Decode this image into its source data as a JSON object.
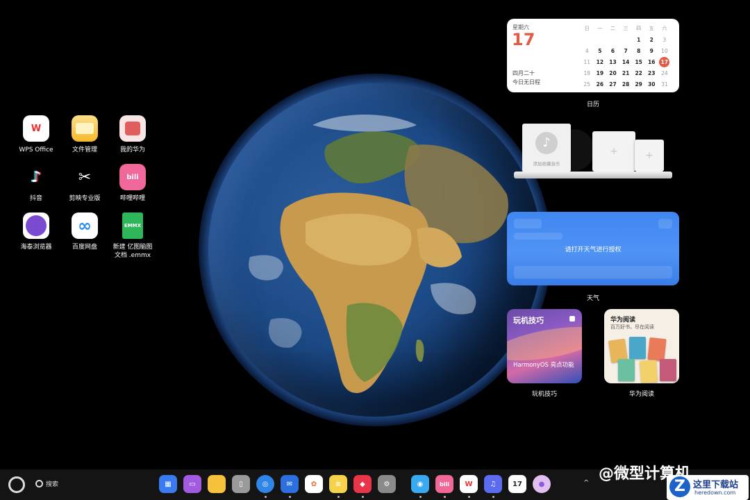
{
  "desktop_icons": [
    {
      "label": "WPS Office",
      "icon": "wps-icon",
      "glyph": "W",
      "bg": "#ffffff",
      "fg": "#e8312f"
    },
    {
      "label": "文件管理",
      "icon": "folder-icon",
      "glyph": "",
      "bg": "#f7c843",
      "fg": "#ffffff"
    },
    {
      "label": "我的华为",
      "icon": "huawei-gift-icon",
      "glyph": "",
      "bg": "#f3dede",
      "fg": "#d04040"
    },
    {
      "label": "抖音",
      "icon": "douyin-icon",
      "glyph": "♪",
      "bg": "#000000",
      "fg": "#ffffff"
    },
    {
      "label": "剪映专业版",
      "icon": "capcut-icon",
      "glyph": "✂",
      "bg": "#000000",
      "fg": "#ffffff"
    },
    {
      "label": "哔哩哔哩",
      "icon": "bilibili-icon",
      "glyph": "bili",
      "bg": "#f0679a",
      "fg": "#ffffff"
    },
    {
      "label": "海泰浏览器",
      "icon": "browser-icon",
      "glyph": "",
      "bg": "#7a4bd0",
      "fg": "#ffffff"
    },
    {
      "label": "百度网盘",
      "icon": "baidu-netdisk-icon",
      "glyph": "∞",
      "bg": "#ffffff",
      "fg": "#2b8cf0"
    },
    {
      "label": "新建 亿图脑图\n文档 .emmx",
      "icon": "emmx-file-icon",
      "glyph": "EMMX",
      "bg": "#2fb55a",
      "fg": "#ffffff"
    }
  ],
  "calendar": {
    "weekday": "星期六",
    "day": "17",
    "lunar": "四月二十",
    "no_event": "今日无日程",
    "headers": [
      "日",
      "一",
      "二",
      "三",
      "四",
      "五",
      "六"
    ],
    "weeks": [
      [
        "",
        "",
        "",
        "",
        "1",
        "2",
        "3"
      ],
      [
        "4",
        "5",
        "6",
        "7",
        "8",
        "9",
        "10"
      ],
      [
        "11",
        "12",
        "13",
        "14",
        "15",
        "16",
        "17"
      ],
      [
        "18",
        "19",
        "20",
        "21",
        "22",
        "23",
        "24"
      ],
      [
        "25",
        "26",
        "27",
        "28",
        "29",
        "30",
        "31"
      ]
    ],
    "today": "17",
    "label": "日历"
  },
  "music": {
    "add_text": "添加收藏音乐",
    "plus": "+"
  },
  "weather": {
    "message": "请打开天气进行授权",
    "label": "天气"
  },
  "tips": {
    "title": "玩机技巧",
    "subtitle": "HarmonyOS 亮点功能",
    "label": "玩机技巧"
  },
  "reading": {
    "title": "华为阅读",
    "subtitle": "百万好书，尽在阅读",
    "label": "华为阅读"
  },
  "taskbar": {
    "search_label": "搜索",
    "dock": [
      {
        "icon": "app-center-icon",
        "glyph": "▦",
        "bg": "#3a7cf0",
        "fg": "#fff"
      },
      {
        "icon": "multitask-icon",
        "glyph": "▭",
        "bg": "#a25be0",
        "fg": "#fff"
      },
      {
        "icon": "files-icon",
        "glyph": "",
        "bg": "#f6c23c",
        "fg": "#fff"
      },
      {
        "icon": "trash-icon",
        "glyph": "▯",
        "bg": "#9a9a9a",
        "fg": "#fff"
      },
      {
        "icon": "browser-icon",
        "glyph": "◎",
        "bg": "#2f86e8",
        "fg": "#fff"
      },
      {
        "icon": "mail-icon",
        "glyph": "✉",
        "bg": "#2e6fe0",
        "fg": "#fff"
      },
      {
        "icon": "gallery-icon",
        "glyph": "✿",
        "bg": "#ffffff",
        "fg": "#e86a2f"
      },
      {
        "icon": "notes-icon",
        "glyph": "≡",
        "bg": "#f5d24b",
        "fg": "#fff"
      },
      {
        "icon": "appgallery-icon",
        "glyph": "◆",
        "bg": "#e8354a",
        "fg": "#fff"
      },
      {
        "icon": "settings-icon",
        "glyph": "⚙",
        "bg": "#8a8a8a",
        "fg": "#fff"
      },
      {
        "icon": "huawei-share-icon",
        "glyph": "◉",
        "bg": "#39a9f0",
        "fg": "#fff"
      },
      {
        "icon": "bilibili-icon",
        "glyph": "bili",
        "bg": "#f0679a",
        "fg": "#fff"
      },
      {
        "icon": "wps-icon",
        "glyph": "W",
        "bg": "#ffffff",
        "fg": "#e8312f"
      },
      {
        "icon": "music-icon",
        "glyph": "♫",
        "bg": "#5c6cf0",
        "fg": "#fff"
      },
      {
        "icon": "calendar-icon",
        "glyph": "17",
        "bg": "#ffffff",
        "fg": "#222"
      },
      {
        "icon": "assistant-icon",
        "glyph": "●",
        "bg": "#e0c0f0",
        "fg": "#8a5be0"
      }
    ],
    "tray_up": "^",
    "tray_icons": [
      "keyboard-icon",
      "volume-icon",
      "wifi-icon"
    ],
    "watermark": "@微型计算机",
    "site_name": "这里下载站",
    "site_url": "heredown.com"
  }
}
